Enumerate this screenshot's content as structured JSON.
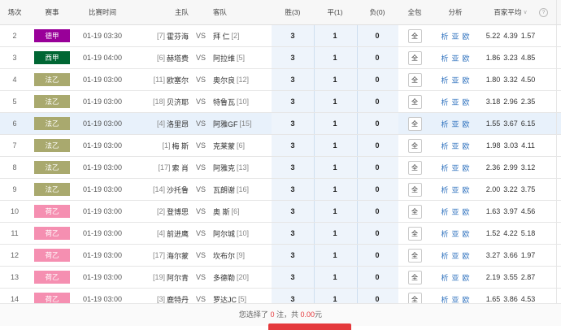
{
  "header": {
    "idx": "场次",
    "league": "赛事",
    "time": "比赛时间",
    "home": "主队",
    "away": "客队",
    "win": "胜(3)",
    "draw": "平(1)",
    "loss": "负(0)",
    "full": "全包",
    "analysis": "分析",
    "avg": "百家平均"
  },
  "rows": [
    {
      "idx": "2",
      "league": "德甲",
      "league_color": "#990099",
      "time": "01-19 03:30",
      "home_rank": "[7]",
      "home": "霍芬海",
      "vs": "VS",
      "away": "拜 仁",
      "away_rank": "[2]",
      "win": "3",
      "draw": "1",
      "loss": "0",
      "full": "全",
      "a1": "析",
      "a2": "亚",
      "a3": "欧",
      "o1": "5.22",
      "o2": "4.39",
      "o3": "1.57"
    },
    {
      "idx": "3",
      "league": "西甲",
      "league_color": "#006633",
      "time": "01-19 04:00",
      "home_rank": "[6]",
      "home": "赫塔费",
      "vs": "VS",
      "away": "阿拉维",
      "away_rank": "[5]",
      "win": "3",
      "draw": "1",
      "loss": "0",
      "full": "全",
      "a1": "析",
      "a2": "亚",
      "a3": "欧",
      "o1": "1.86",
      "o2": "3.23",
      "o3": "4.85"
    },
    {
      "idx": "4",
      "league": "法乙",
      "league_color": "#a9a96e",
      "time": "01-19 03:00",
      "home_rank": "[11]",
      "home": "欧塞尔",
      "vs": "VS",
      "away": "奥尔良",
      "away_rank": "[12]",
      "win": "3",
      "draw": "1",
      "loss": "0",
      "full": "全",
      "a1": "析",
      "a2": "亚",
      "a3": "欧",
      "o1": "1.80",
      "o2": "3.32",
      "o3": "4.50"
    },
    {
      "idx": "5",
      "league": "法乙",
      "league_color": "#a9a96e",
      "time": "01-19 03:00",
      "home_rank": "[18]",
      "home": "贝济耶",
      "vs": "VS",
      "away": "特鲁瓦",
      "away_rank": "[10]",
      "win": "3",
      "draw": "1",
      "loss": "0",
      "full": "全",
      "a1": "析",
      "a2": "亚",
      "a3": "欧",
      "o1": "3.18",
      "o2": "2.96",
      "o3": "2.35"
    },
    {
      "idx": "6",
      "league": "法乙",
      "league_color": "#a9a96e",
      "time": "01-19 03:00",
      "home_rank": "[4]",
      "home": "洛里昂",
      "vs": "VS",
      "away": "阿雅GF",
      "away_rank": "[15]",
      "win": "3",
      "draw": "1",
      "loss": "0",
      "full": "全",
      "a1": "析",
      "a2": "亚",
      "a3": "欧",
      "o1": "1.55",
      "o2": "3.67",
      "o3": "6.15"
    },
    {
      "idx": "7",
      "league": "法乙",
      "league_color": "#a9a96e",
      "time": "01-19 03:00",
      "home_rank": "[1]",
      "home": "梅 斯",
      "vs": "VS",
      "away": "克莱蒙",
      "away_rank": "[6]",
      "win": "3",
      "draw": "1",
      "loss": "0",
      "full": "全",
      "a1": "析",
      "a2": "亚",
      "a3": "欧",
      "o1": "1.98",
      "o2": "3.03",
      "o3": "4.11"
    },
    {
      "idx": "8",
      "league": "法乙",
      "league_color": "#a9a96e",
      "time": "01-19 03:00",
      "home_rank": "[17]",
      "home": "索 肖",
      "vs": "VS",
      "away": "阿雅克",
      "away_rank": "[13]",
      "win": "3",
      "draw": "1",
      "loss": "0",
      "full": "全",
      "a1": "析",
      "a2": "亚",
      "a3": "欧",
      "o1": "2.36",
      "o2": "2.99",
      "o3": "3.12"
    },
    {
      "idx": "9",
      "league": "法乙",
      "league_color": "#a9a96e",
      "time": "01-19 03:00",
      "home_rank": "[14]",
      "home": "沙托鲁",
      "vs": "VS",
      "away": "瓦朗谢",
      "away_rank": "[16]",
      "win": "3",
      "draw": "1",
      "loss": "0",
      "full": "全",
      "a1": "析",
      "a2": "亚",
      "a3": "欧",
      "o1": "2.00",
      "o2": "3.22",
      "o3": "3.75"
    },
    {
      "idx": "10",
      "league": "荷乙",
      "league_color": "#f58fb1",
      "time": "01-19 03:00",
      "home_rank": "[2]",
      "home": "登博思",
      "vs": "VS",
      "away": "奥 斯",
      "away_rank": "[6]",
      "win": "3",
      "draw": "1",
      "loss": "0",
      "full": "全",
      "a1": "析",
      "a2": "亚",
      "a3": "欧",
      "o1": "1.63",
      "o2": "3.97",
      "o3": "4.56"
    },
    {
      "idx": "11",
      "league": "荷乙",
      "league_color": "#f58fb1",
      "time": "01-19 03:00",
      "home_rank": "[4]",
      "home": "前进鹰",
      "vs": "VS",
      "away": "阿尔城",
      "away_rank": "[10]",
      "win": "3",
      "draw": "1",
      "loss": "0",
      "full": "全",
      "a1": "析",
      "a2": "亚",
      "a3": "欧",
      "o1": "1.52",
      "o2": "4.22",
      "o3": "5.18"
    },
    {
      "idx": "12",
      "league": "荷乙",
      "league_color": "#f58fb1",
      "time": "01-19 03:00",
      "home_rank": "[17]",
      "home": "海尔蒙",
      "vs": "VS",
      "away": "坎布尔",
      "away_rank": "[9]",
      "win": "3",
      "draw": "1",
      "loss": "0",
      "full": "全",
      "a1": "析",
      "a2": "亚",
      "a3": "欧",
      "o1": "3.27",
      "o2": "3.66",
      "o3": "1.97"
    },
    {
      "idx": "13",
      "league": "荷乙",
      "league_color": "#f58fb1",
      "time": "01-19 03:00",
      "home_rank": "[19]",
      "home": "阿尔青",
      "vs": "VS",
      "away": "多德勒",
      "away_rank": "[20]",
      "win": "3",
      "draw": "1",
      "loss": "0",
      "full": "全",
      "a1": "析",
      "a2": "亚",
      "a3": "欧",
      "o1": "2.19",
      "o2": "3.55",
      "o3": "2.87"
    },
    {
      "idx": "14",
      "league": "荷乙",
      "league_color": "#f58fb1",
      "time": "01-19 03:00",
      "home_rank": "[3]",
      "home": "鹿特丹",
      "vs": "VS",
      "away": "罗达JC",
      "away_rank": "[5]",
      "win": "3",
      "draw": "1",
      "loss": "0",
      "full": "全",
      "a1": "析",
      "a2": "亚",
      "a3": "欧",
      "o1": "1.65",
      "o2": "3.86",
      "o3": "4.53"
    }
  ],
  "footer": {
    "prefix": "您选择了",
    "count": "0",
    "mid": "注，共",
    "amount": "0.00",
    "suffix": "元"
  }
}
